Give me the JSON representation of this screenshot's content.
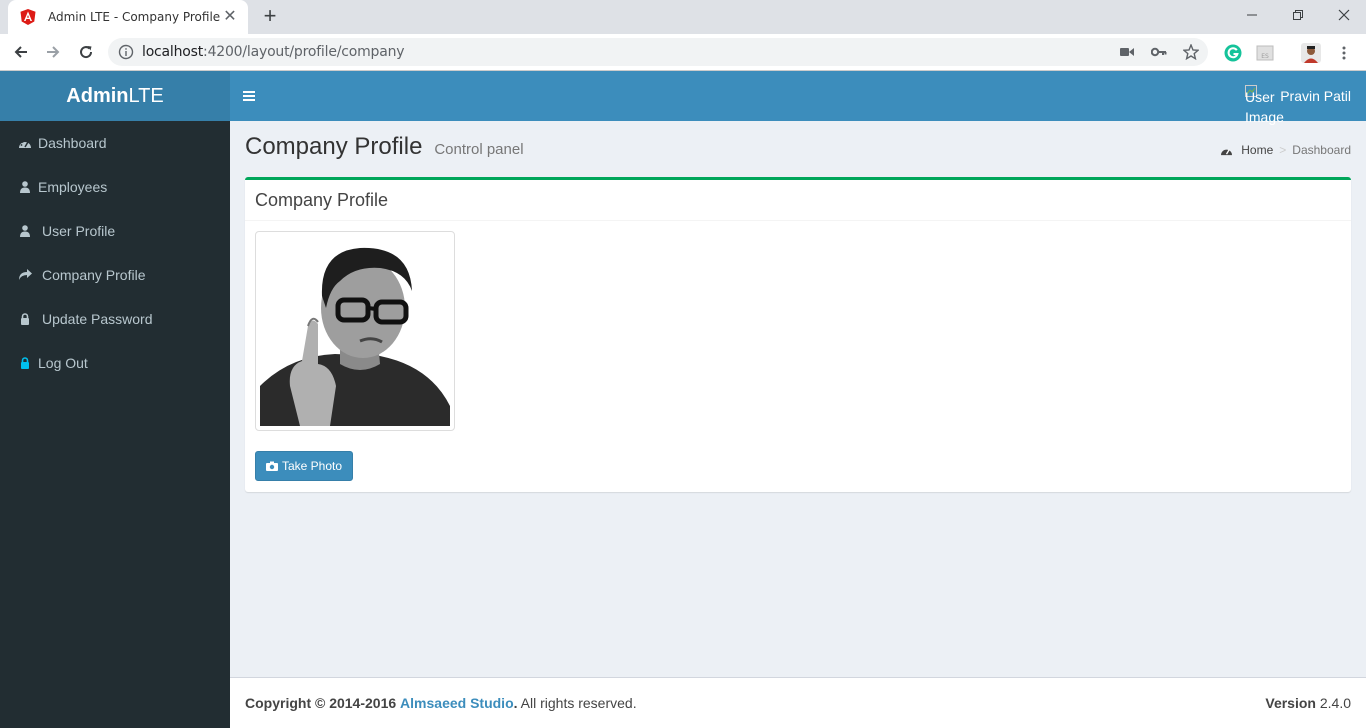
{
  "browser": {
    "tab_title": "Admin LTE - Company Profile",
    "url_host": "localhost",
    "url_rest": ":4200/layout/profile/company",
    "colors": {
      "angular_red": "#dd1b16",
      "grammarly_green": "#15c39a"
    }
  },
  "header": {
    "logo_bold": "Admin",
    "logo_light": "LTE",
    "user_image_alt": "User Image",
    "user_name": "Pravin Patil"
  },
  "sidebar": {
    "items": [
      {
        "label": "Dashboard",
        "icon": "dashboard-icon"
      },
      {
        "label": "Employees",
        "icon": "user-icon"
      },
      {
        "label": "User Profile",
        "icon": "user-icon"
      },
      {
        "label": "Company Profile",
        "icon": "share-icon"
      },
      {
        "label": "Update Password",
        "icon": "lock-icon"
      },
      {
        "label": "Log Out",
        "icon": "lock-icon"
      }
    ]
  },
  "content": {
    "title": "Company Profile",
    "subtitle": "Control panel",
    "breadcrumb": {
      "home": "Home",
      "active": "Dashboard"
    },
    "box_title": "Company Profile",
    "take_photo_label": "Take Photo"
  },
  "footer": {
    "copyright_prefix": "Copyright © 2014-2016",
    "studio": "Almsaeed Studio",
    "suffix": ". All rights reserved.",
    "version_label": "Version",
    "version_number": "2.4.0"
  },
  "colors": {
    "logo_bg": "#367fa9",
    "navbar_bg": "#3c8dbc",
    "sidebar_bg": "#222d32",
    "sidebar_text": "#b8c7ce",
    "box_border": "#00a65a",
    "logout_icon": "#00c0ef"
  }
}
